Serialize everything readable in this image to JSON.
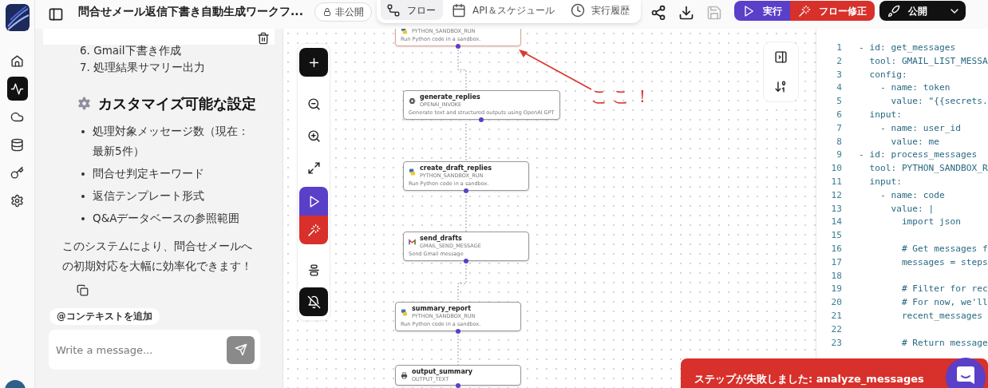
{
  "rail": {
    "items": [
      {
        "kind": "home",
        "selected": false
      },
      {
        "kind": "activity",
        "selected": true
      },
      {
        "kind": "cloud",
        "selected": false
      },
      {
        "kind": "database",
        "selected": false
      },
      {
        "kind": "key",
        "selected": false
      },
      {
        "kind": "settings",
        "selected": false
      }
    ]
  },
  "topbar": {
    "title": "問合せメール返信下書き自動生成ワークフ...",
    "visibility": "非公開",
    "tabs": [
      {
        "kind": "flow",
        "label": "フロー",
        "selected": true
      },
      {
        "kind": "calendar",
        "label": "API＆スケジュール",
        "selected": false
      },
      {
        "kind": "history",
        "label": "実行履歴",
        "selected": false
      }
    ],
    "tools": [
      {
        "kind": "share",
        "disabled": false
      },
      {
        "kind": "download",
        "disabled": false
      },
      {
        "kind": "save",
        "disabled": true
      }
    ],
    "run_button": "実行",
    "fix_button": "フロー修正",
    "publish_button": "公開"
  },
  "chat": {
    "steps": [
      "6. Gmail下書き作成",
      "7. 処理結果サマリー出力"
    ],
    "heading": "カスタマイズ可能な設定",
    "bullets": [
      "処理対象メッセージ数（現在：最新5件）",
      "問合せ判定キーワード",
      "返信テンプレート形式",
      "Q&Aデータベースの参照範囲"
    ],
    "paragraph": "このシステムにより、問合せメールへの初期対応を大幅に効率化できます！",
    "context_chip": "@コンテキストを追加",
    "input": {
      "placeholder": "Write a message..."
    }
  },
  "canvas": {
    "nodes": [
      {
        "kind": "python",
        "tool": "PYTHON_SANDBOX_RUN",
        "description": "Run Python code in a sandbox.",
        "selected": true
      },
      {
        "kind": "openai",
        "title": "generate_replies",
        "tool": "OPENAI_INVOKE",
        "description": "Generate text and structured outputs using OpenAI GPT",
        "selected": false
      },
      {
        "kind": "python",
        "title": "create_draft_replies",
        "tool": "PYTHON_SANDBOX_RUN",
        "description": "Run Python code in a sandbox.",
        "selected": false
      },
      {
        "kind": "gmail",
        "title": "send_drafts",
        "tool": "GMAIL_SEND_MESSAGE",
        "description": "Send Gmail message",
        "selected": false
      },
      {
        "kind": "python",
        "title": "summary_report",
        "tool": "PYTHON_SANDBOX_RUN",
        "description": "Run Python code in a sandbox.",
        "selected": false
      },
      {
        "kind": "output",
        "title": "output_summary",
        "tool": "OUTPUT_TEXT",
        "selected": false
      }
    ],
    "annotation": "ここ！"
  },
  "code": {
    "lines": [
      {
        "number": "1",
        "text": "- id: get_messages"
      },
      {
        "number": "2",
        "text": "  tool: GMAIL_LIST_MESSA"
      },
      {
        "number": "3",
        "text": "  config:"
      },
      {
        "number": "4",
        "text": "    - name: token"
      },
      {
        "number": "5",
        "text": "      value: \"{{secrets."
      },
      {
        "number": "6",
        "text": "  input:"
      },
      {
        "number": "7",
        "text": "    - name: user_id"
      },
      {
        "number": "8",
        "text": "      value: me"
      },
      {
        "number": "9",
        "text": "- id: process_messages"
      },
      {
        "number": "10",
        "text": "  tool: PYTHON_SANDBOX_R"
      },
      {
        "number": "11",
        "text": "  input:"
      },
      {
        "number": "12",
        "text": "    - name: code"
      },
      {
        "number": "13",
        "text": "      value: |"
      },
      {
        "number": "14",
        "text": "        import json"
      },
      {
        "number": "15"
      },
      {
        "number": "16",
        "text": "        # Get messages f"
      },
      {
        "number": "17",
        "text": "        messages = steps"
      },
      {
        "number": "18"
      },
      {
        "number": "19",
        "text": "        # Filter for rec"
      },
      {
        "number": "20",
        "text": "        # For now, we'll"
      },
      {
        "number": "21",
        "text": "        recent_messages"
      },
      {
        "number": "22"
      },
      {
        "number": "23",
        "text": "        # Return message"
      }
    ]
  },
  "toast": {
    "message": "ステップが失敗しました: analyze_messages"
  }
}
